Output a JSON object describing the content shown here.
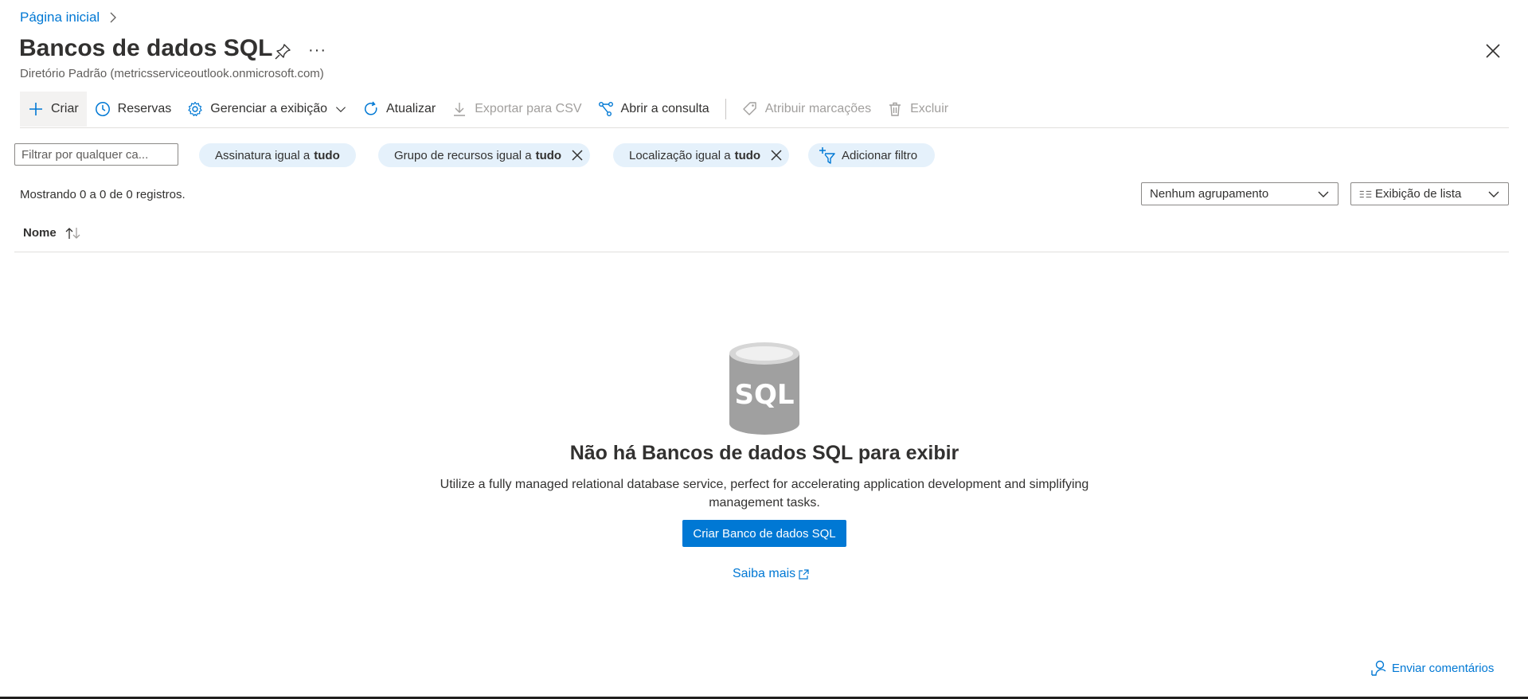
{
  "breadcrumb": {
    "home": "Página inicial"
  },
  "header": {
    "title": "Bancos de dados SQL",
    "more": "···",
    "subtitle": "Diretório Padrão (metricsserviceoutlook.onmicrosoft.com)"
  },
  "toolbar": {
    "create": "Criar",
    "reservations": "Reservas",
    "manage_view": "Gerenciar a exibição",
    "refresh": "Atualizar",
    "export_csv": "Exportar para CSV",
    "open_query": "Abrir a consulta",
    "assign_tags": "Atribuir marcações",
    "delete": "Excluir"
  },
  "filters": {
    "search_placeholder": "Filtrar por qualquer ca...",
    "subscription": {
      "label": "Assinatura igual a",
      "value": "tudo"
    },
    "resource_group": {
      "label": "Grupo de recursos igual a",
      "value": "tudo"
    },
    "location": {
      "label": "Localização igual a",
      "value": "tudo"
    },
    "add_filter": "Adicionar filtro"
  },
  "records": {
    "summary": "Mostrando 0 a 0 de 0 registros.",
    "grouping": "Nenhum agrupamento",
    "view": "Exibição de lista"
  },
  "table": {
    "columns": [
      "Nome"
    ]
  },
  "empty_state": {
    "icon_text": "SQL",
    "title": "Não há Bancos de dados SQL para exibir",
    "description": "Utilize a fully managed relational database service, perfect for accelerating application development and simplifying management tasks.",
    "create_button": "Criar Banco de dados SQL",
    "learn_more": "Saiba mais"
  },
  "footer": {
    "feedback": "Enviar comentários"
  },
  "colors": {
    "accent": "#0078d4",
    "pill_bg": "#e5f1fb",
    "disabled": "#a19f9d"
  }
}
